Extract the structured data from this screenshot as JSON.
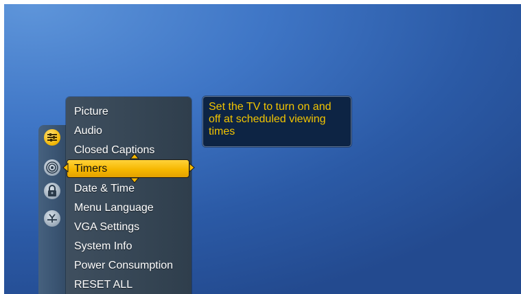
{
  "menu": {
    "items": [
      {
        "label": "Picture"
      },
      {
        "label": "Audio"
      },
      {
        "label": "Closed Captions"
      },
      {
        "label": "Timers"
      },
      {
        "label": "Date & Time"
      },
      {
        "label": "Menu Language"
      },
      {
        "label": "VGA Settings"
      },
      {
        "label": "System Info"
      },
      {
        "label": "Power Consumption"
      },
      {
        "label": "RESET ALL"
      }
    ],
    "selected_index": 3
  },
  "icons": [
    "settings-icon",
    "broadcast-icon",
    "lock-icon",
    "antenna-icon"
  ],
  "info": {
    "description": "Set the TV to turn on and off at scheduled viewing times"
  },
  "colors": {
    "highlight": "#f6b800",
    "info_text": "#f2c400",
    "info_bg": "#0d2444"
  }
}
